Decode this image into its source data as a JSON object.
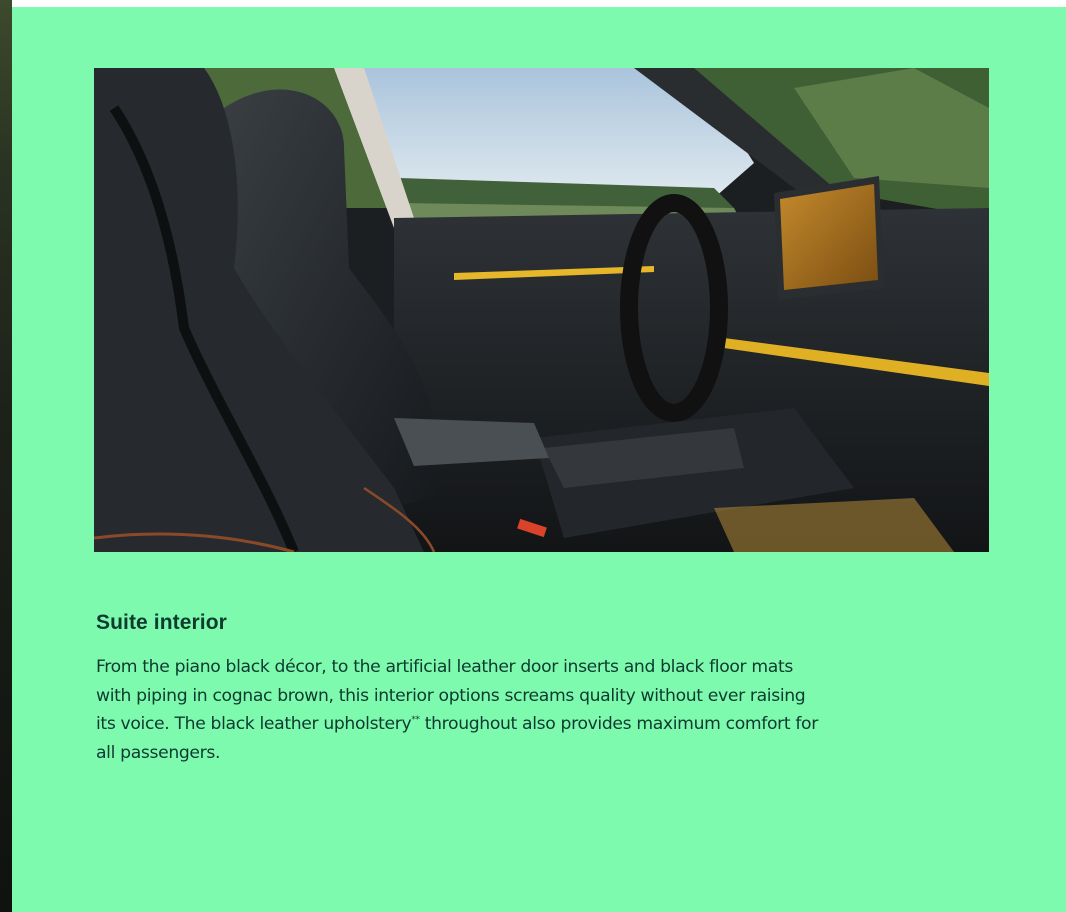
{
  "page": {
    "background": "#7dfaae",
    "text_color": "#0e3a2f"
  },
  "section": {
    "image_subject": "car-interior-photo",
    "title": "Suite interior",
    "body": "From the piano black décor, to the artificial leather door inserts and black floor mats with piping in cognac brown, this interior options screams quality without ever raising its voice. The black leather upholstery",
    "footnote_marker": "**",
    "body_end": " throughout also provides maximum comfort for all passengers."
  }
}
